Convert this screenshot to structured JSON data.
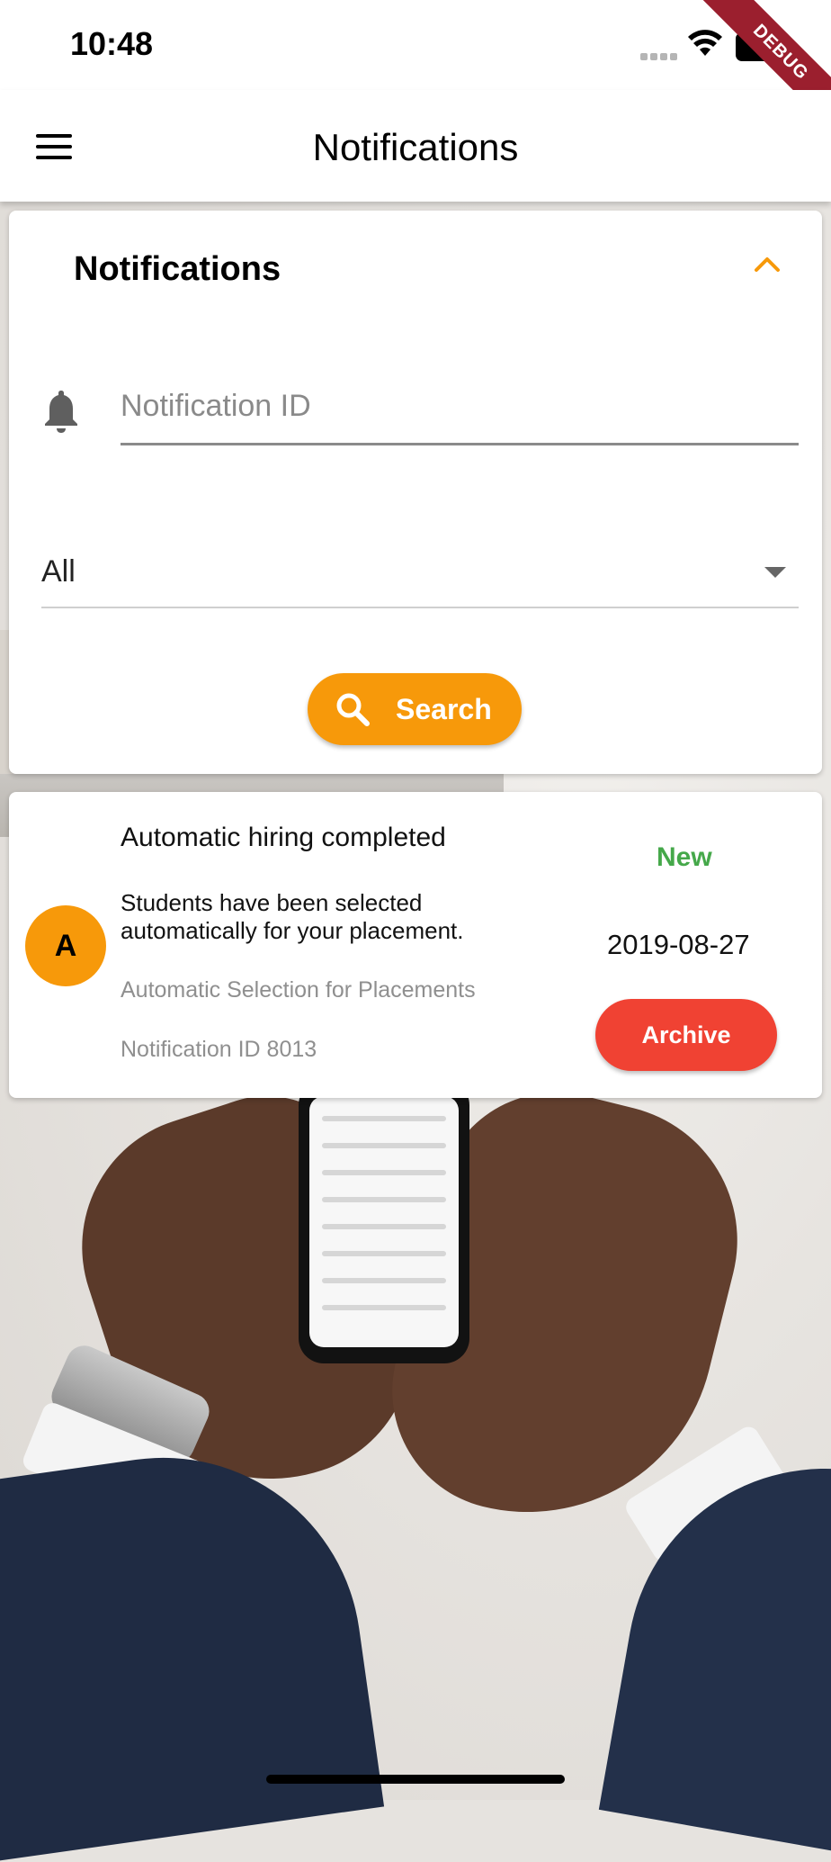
{
  "status_bar": {
    "time": "10:48",
    "debug_label": "DEBUG",
    "icons": [
      "signal-icon",
      "wifi-icon",
      "battery-icon"
    ]
  },
  "app_bar": {
    "title": "Notifications",
    "menu_icon": "menu-icon"
  },
  "search_panel": {
    "heading": "Notifications",
    "collapse_icon": "chevron-up-icon",
    "id_field": {
      "icon": "bell-icon",
      "placeholder": "Notification ID",
      "value": ""
    },
    "filter": {
      "selected": "All",
      "icon": "dropdown-arrow-icon"
    },
    "search_button": {
      "label": "Search",
      "icon": "search-icon"
    }
  },
  "notifications": [
    {
      "avatar": "A",
      "title": "Automatic hiring completed",
      "body": "Students have been selected automatically for your placement.",
      "source": "Automatic Selection for Placements",
      "id_text": "Notification ID 8013",
      "status": "New",
      "date": "2019-08-27",
      "action": "Archive"
    }
  ],
  "colors": {
    "accent": "#f7990a",
    "status_new": "#45a84a",
    "archive": "#f04233"
  }
}
